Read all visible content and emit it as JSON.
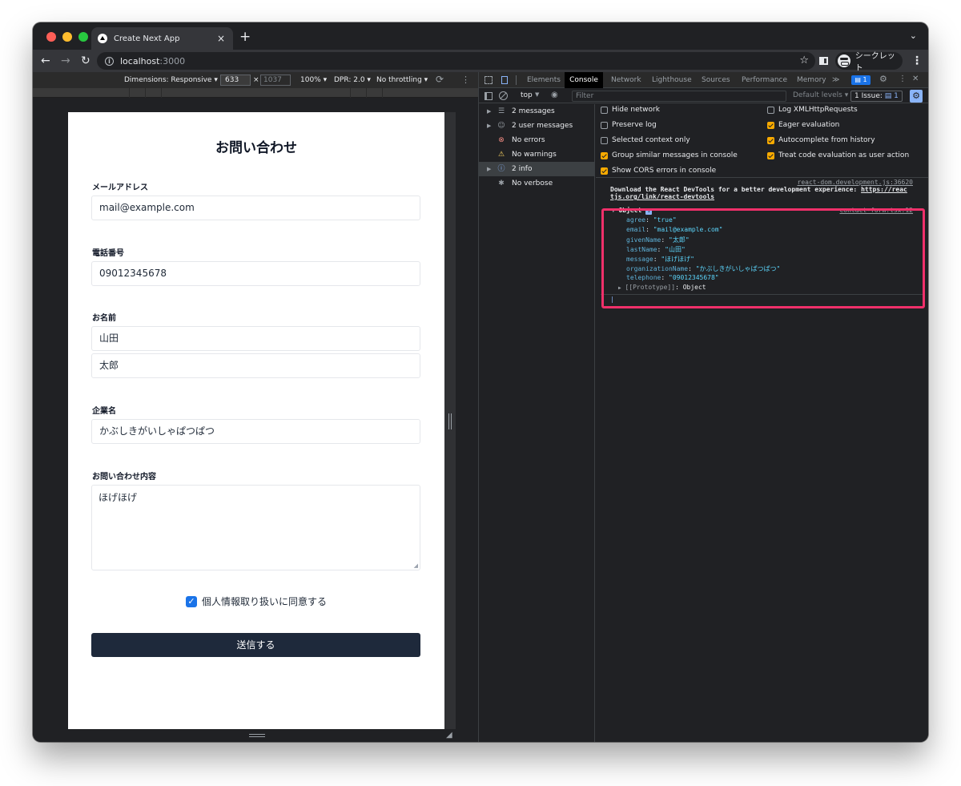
{
  "browser": {
    "tab_title": "Create Next App",
    "tab_close": "×",
    "new_tab": "+",
    "tab_menu": "⌄",
    "url_host": "localhost",
    "url_port": ":3000",
    "incognito_label": "シークレット"
  },
  "device_toolbar": {
    "dimensions": "Dimensions: Responsive ▾",
    "width": "633",
    "times": "×",
    "height": "1037",
    "zoom": "100% ▾",
    "dpr": "DPR: 2.0 ▾",
    "throttling": "No throttling ▾"
  },
  "form": {
    "title": "お問い合わせ",
    "email_label": "メールアドレス",
    "email_value": "mail@example.com",
    "phone_label": "電話番号",
    "phone_value": "09012345678",
    "name_label": "お名前",
    "last_name_value": "山田",
    "given_name_value": "太郎",
    "company_label": "企業名",
    "company_value": "かぶしきがいしゃぱつぱつ",
    "message_label": "お問い合わせ内容",
    "message_value": "ほげほげ",
    "agree_label": "個人情報取り扱いに同意する",
    "agree_checked": true,
    "submit_label": "送信する"
  },
  "devtools": {
    "tabs": [
      "Elements",
      "Console",
      "Network",
      "Lighthouse",
      "Sources",
      "Performance",
      "Memory",
      "≫"
    ],
    "active_tab": "Console",
    "issues_badge": "1",
    "context": "top",
    "filter_placeholder": "Filter",
    "default_levels": "Default levels ▾",
    "issue_label": "1 Issue:",
    "issue_count": "1",
    "sidebar": [
      {
        "label": "2 messages",
        "icon": "list-icon",
        "arrow": "▶"
      },
      {
        "label": "2 user messages",
        "icon": "user-icon",
        "arrow": "▶"
      },
      {
        "label": "No errors",
        "icon": "error-icon",
        "arrow": ""
      },
      {
        "label": "No warnings",
        "icon": "warning-icon",
        "arrow": ""
      },
      {
        "label": "2 info",
        "icon": "info-icon",
        "arrow": "▶"
      },
      {
        "label": "No verbose",
        "icon": "bug-icon",
        "arrow": ""
      }
    ],
    "settings": {
      "hide_network": "Hide network",
      "preserve_log": "Preserve log",
      "selected_context": "Selected context only",
      "group_similar": "Group similar messages in console",
      "show_cors": "Show CORS errors in console",
      "log_xhr": "Log XMLHttpRequests",
      "eager_eval": "Eager evaluation",
      "autocomplete": "Autocomplete from history",
      "treat_code": "Treat code evaluation as user action"
    },
    "console": {
      "msg1_source": "react-dom.development.js:36620",
      "msg1_text_a": "Download the React DevTools for a better development experience: ",
      "msg1_link_a": "https://reac",
      "msg1_link_b": "tjs.org/link/react-devtools",
      "msg2_source": "contact-form.tsx:12",
      "object_label": "Object",
      "props": [
        {
          "key": "agree",
          "value": "\"true\""
        },
        {
          "key": "email",
          "value": "\"mail@example.com\""
        },
        {
          "key": "givenName",
          "value": "\"太郎\""
        },
        {
          "key": "lastName",
          "value": "\"山田\""
        },
        {
          "key": "message",
          "value": "\"ほげほげ\""
        },
        {
          "key": "organizationName",
          "value": "\"かぶしきがいしゃぱつぱつ\""
        },
        {
          "key": "telephone",
          "value": "\"09012345678\""
        }
      ],
      "prototype_key": "[[Prototype]]",
      "prototype_value": "Object"
    }
  },
  "colors": {
    "highlight": "#f0306a",
    "submit_bg": "#1e293b",
    "checkbox": "#1a73e8"
  }
}
